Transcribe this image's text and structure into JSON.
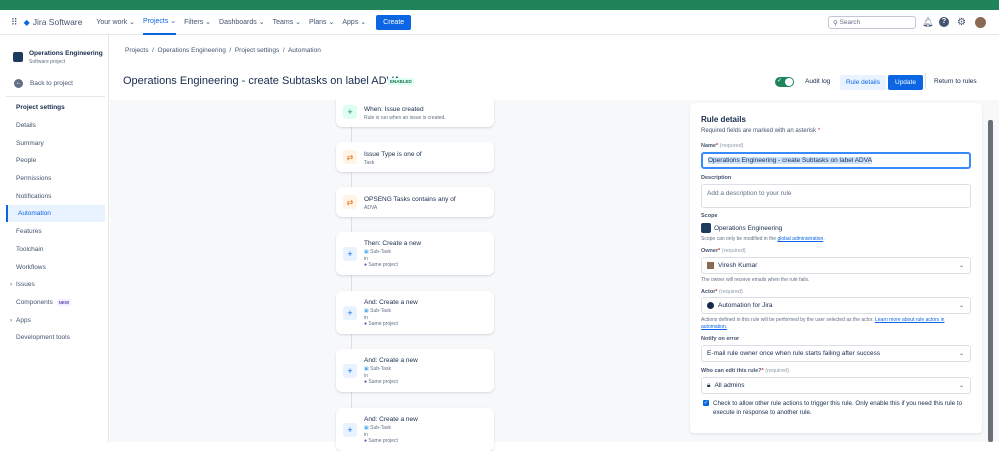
{
  "nav": {
    "app_name": "Jira Software",
    "items": [
      "Your work",
      "Projects",
      "Filters",
      "Dashboards",
      "Teams",
      "Plans",
      "Apps"
    ],
    "active": "Projects",
    "create_label": "Create",
    "search_placeholder": "Search"
  },
  "sidebar": {
    "project_name": "Operations Engineering",
    "project_type": "Software project",
    "back_label": "Back to project",
    "section_title": "Project settings",
    "items": [
      {
        "label": "Details"
      },
      {
        "label": "Summary"
      },
      {
        "label": "People"
      },
      {
        "label": "Permissions"
      },
      {
        "label": "Notifications"
      },
      {
        "label": "Automation"
      },
      {
        "label": "Features"
      },
      {
        "label": "Toolchain"
      },
      {
        "label": "Workflows"
      },
      {
        "label": "Issues"
      },
      {
        "label": "Components",
        "badge": "NEW"
      },
      {
        "label": "Apps"
      },
      {
        "label": "Development tools"
      }
    ]
  },
  "breadcrumb": [
    "Projects",
    "Operations Engineering",
    "Project settings",
    "Automation"
  ],
  "header": {
    "title": "Operations Engineering - create Subtasks on label ADVA",
    "status": "ENABLED",
    "audit_log": "Audit log",
    "rule_details": "Rule details",
    "update": "Update",
    "return": "Return to rules",
    "toggle_on": true
  },
  "flow": [
    {
      "title": "When: Issue created",
      "sub": "Rule is run when an issue is created.",
      "type": "trigger"
    },
    {
      "title": "Issue Type is one of",
      "sub": "Task",
      "type": "condition"
    },
    {
      "title": "OPSENG Tasks contains any of",
      "sub": "ADVA",
      "type": "condition"
    },
    {
      "title": "Then: Create a new",
      "issue_type": "Sub-Task",
      "in": "in",
      "project": "Same project",
      "type": "action"
    },
    {
      "title": "And: Create a new",
      "issue_type": "Sub-Task",
      "in": "in",
      "project": "Same project",
      "type": "action"
    },
    {
      "title": "And: Create a new",
      "issue_type": "Sub-Task",
      "in": "in",
      "project": "Same project",
      "type": "action"
    },
    {
      "title": "And: Create a new",
      "issue_type": "Sub-Task",
      "in": "in",
      "project": "Same project",
      "type": "action"
    }
  ],
  "panel": {
    "title": "Rule details",
    "required_note": "Required fields are marked with an asterisk",
    "required_tag": "(required)",
    "name_label": "Name",
    "name_value": "Operations Engineering - create Subtasks on label ADVA",
    "desc_label": "Description",
    "desc_placeholder": "Add a description to your rule",
    "scope_label": "Scope",
    "scope_value": "Operations Engineering",
    "scope_help": "Scope can only be modified in the",
    "scope_link": "global administration",
    "owner_label": "Owner",
    "owner_value": "Viresh Kumar",
    "owner_help": "The owner will receive emails when the rule fails.",
    "actor_label": "Actor",
    "actor_value": "Automation for Jira",
    "actor_help": "Actions defined in this rule will be performed by the user selected as the actor.",
    "actor_link": "Learn more about rule actors in automation.",
    "notify_label": "Notify on error",
    "notify_value": "E-mail rule owner once when rule starts failing after success",
    "edit_label": "Who can edit this rule?",
    "edit_value": "All admins",
    "checkbox_label": "Check to allow other rule actions to trigger this rule. Only enable this if you need this rule to execute in response to another rule.",
    "checkbox_checked": true
  }
}
